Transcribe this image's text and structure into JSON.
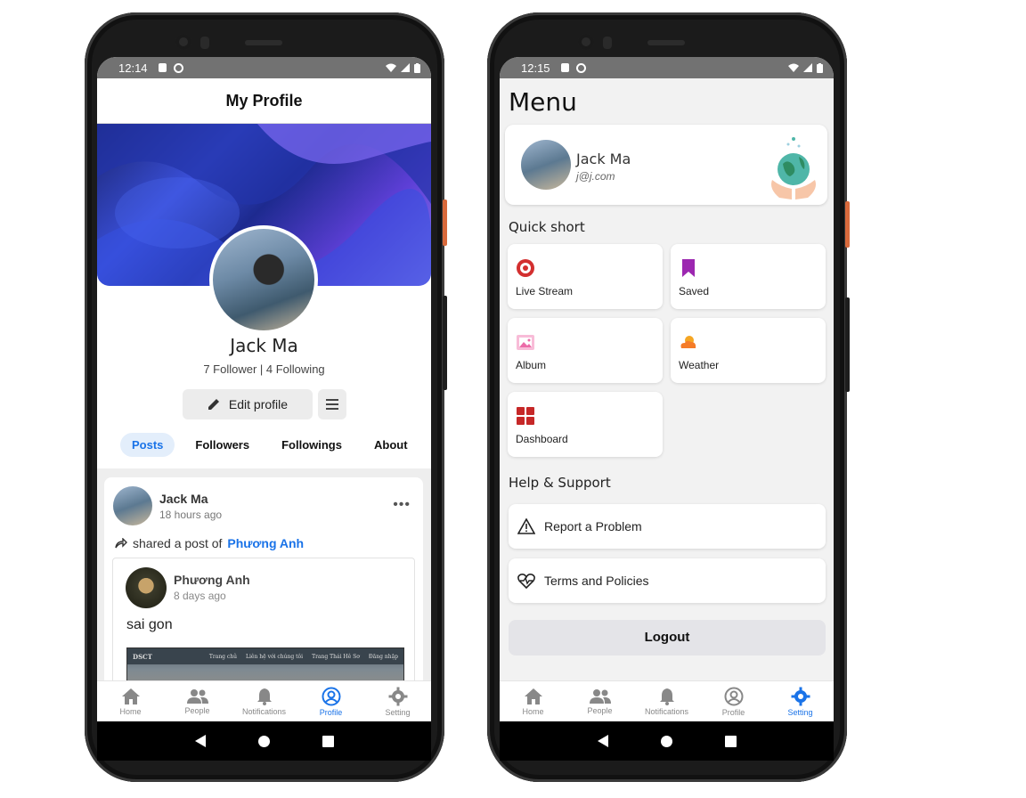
{
  "left_phone": {
    "status": {
      "time": "12:14"
    },
    "appbar": {
      "title": "My Profile"
    },
    "profile": {
      "name": "Jack Ma",
      "stats": "7 Follower | 4 Following",
      "edit_label": "Edit profile"
    },
    "tabs": [
      {
        "label": "Posts",
        "active": true
      },
      {
        "label": "Followers",
        "active": false
      },
      {
        "label": "Followings",
        "active": false
      },
      {
        "label": "About",
        "active": false
      }
    ],
    "post": {
      "author": "Jack Ma",
      "time": "18 hours ago",
      "shared_prefix": "shared a post of",
      "shared_who": "Phương Anh",
      "inner": {
        "author": "Phương Anh",
        "time": "8 days ago",
        "text": "sai gon",
        "image_header": {
          "brand": "DSCT",
          "links": [
            "Trang chủ",
            "Liên hệ với chúng tôi",
            "Trang Thái Hê Sơ",
            "Đăng nhập"
          ]
        }
      }
    },
    "bottom_nav": [
      {
        "label": "Home",
        "icon": "home-icon",
        "active": false
      },
      {
        "label": "People",
        "icon": "people-icon",
        "active": false
      },
      {
        "label": "Notifications",
        "icon": "bell-icon",
        "active": false
      },
      {
        "label": "Profile",
        "icon": "profile-icon",
        "active": true
      },
      {
        "label": "Setting",
        "icon": "gear-icon",
        "active": false
      }
    ]
  },
  "right_phone": {
    "status": {
      "time": "12:15"
    },
    "title": "Menu",
    "user": {
      "name": "Jack Ma",
      "email": "j@j.com"
    },
    "quick_short": {
      "label": "Quick short",
      "items": [
        {
          "label": "Live Stream",
          "icon": "live-stream-icon",
          "color": "#d32f2f"
        },
        {
          "label": "Saved",
          "icon": "bookmark-icon",
          "color": "#9c27b0"
        },
        {
          "label": "Album",
          "icon": "album-icon",
          "color": "#ec6ba8"
        },
        {
          "label": "Weather",
          "icon": "weather-icon",
          "color": "#f57c28"
        },
        {
          "label": "Dashboard",
          "icon": "dashboard-icon",
          "color": "#c62828"
        }
      ]
    },
    "help": {
      "label": "Help & Support",
      "items": [
        {
          "label": "Report a Problem",
          "icon": "warning-icon"
        },
        {
          "label": "Terms and Policies",
          "icon": "heart-pulse-icon"
        }
      ]
    },
    "logout_label": "Logout",
    "bottom_nav": [
      {
        "label": "Home",
        "icon": "home-icon",
        "active": false
      },
      {
        "label": "People",
        "icon": "people-icon",
        "active": false
      },
      {
        "label": "Notifications",
        "icon": "bell-icon",
        "active": false
      },
      {
        "label": "Profile",
        "icon": "profile-icon",
        "active": false
      },
      {
        "label": "Setting",
        "icon": "gear-icon",
        "active": true
      }
    ]
  },
  "colors": {
    "accent": "#1a73e8",
    "status_bar": "#727272"
  }
}
